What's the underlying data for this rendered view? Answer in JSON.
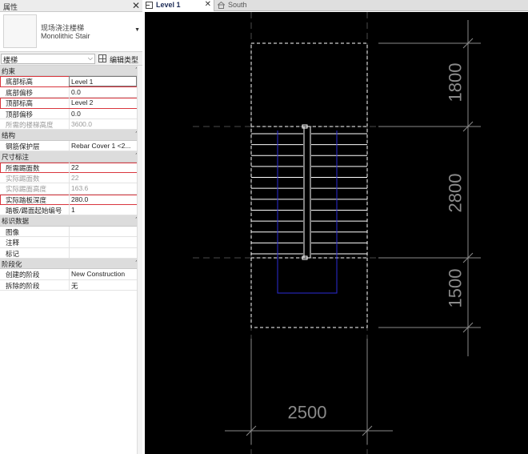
{
  "properties_panel": {
    "title": "属性",
    "close_glyph": "✕",
    "type_name": "现场浇注楼梯",
    "type_subname": "Monolithic Stair",
    "filter_value": "楼梯",
    "edit_type_label": "编辑类型",
    "categories": [
      {
        "label": "约束",
        "rows": [
          {
            "label": "底部标高",
            "value": "Level 1",
            "highlight": true,
            "active": true,
            "readonly": false
          },
          {
            "label": "底部偏移",
            "value": "0.0",
            "highlight": false,
            "active": false,
            "readonly": false
          },
          {
            "label": "顶部标高",
            "value": "Level 2",
            "highlight": true,
            "active": false,
            "readonly": false
          },
          {
            "label": "顶部偏移",
            "value": "0.0",
            "highlight": false,
            "active": false,
            "readonly": false
          },
          {
            "label": "所需的楼梯高度",
            "value": "3600.0",
            "highlight": false,
            "active": false,
            "readonly": true
          }
        ]
      },
      {
        "label": "结构",
        "rows": [
          {
            "label": "钢筋保护层",
            "value": "Rebar Cover 1 <2...",
            "highlight": false,
            "active": false,
            "readonly": false
          }
        ]
      },
      {
        "label": "尺寸标注",
        "rows": [
          {
            "label": "所需踢面数",
            "value": "22",
            "highlight": true,
            "active": false,
            "readonly": false
          },
          {
            "label": "实际踢面数",
            "value": "22",
            "highlight": false,
            "active": false,
            "readonly": true
          },
          {
            "label": "实际踢面高度",
            "value": "163.6",
            "highlight": false,
            "active": false,
            "readonly": true
          },
          {
            "label": "实际踏板深度",
            "value": "280.0",
            "highlight": true,
            "active": false,
            "readonly": false
          },
          {
            "label": "踏板/踢面起始编号",
            "value": "1",
            "highlight": false,
            "active": false,
            "readonly": false
          }
        ]
      },
      {
        "label": "标识数据",
        "rows": [
          {
            "label": "图像",
            "value": "",
            "highlight": false,
            "active": false,
            "readonly": false
          },
          {
            "label": "注释",
            "value": "",
            "highlight": false,
            "active": false,
            "readonly": false
          },
          {
            "label": "标记",
            "value": "",
            "highlight": false,
            "active": false,
            "readonly": false
          }
        ]
      },
      {
        "label": "阶段化",
        "rows": [
          {
            "label": "创建的阶段",
            "value": "New Construction",
            "highlight": false,
            "active": false,
            "readonly": false
          },
          {
            "label": "拆除的阶段",
            "value": "无",
            "highlight": false,
            "active": false,
            "readonly": false
          }
        ]
      }
    ]
  },
  "tabs": [
    {
      "label": "Level 1",
      "active": true,
      "closable": true,
      "icon": "floor-plan-icon"
    },
    {
      "label": "South",
      "active": false,
      "closable": false,
      "icon": "elevation-icon"
    }
  ],
  "drawing": {
    "dimensions": {
      "landing_top": "1800",
      "stair_run": "2800",
      "landing_bottom": "1500",
      "width": "2500"
    },
    "colors": {
      "background": "#000000",
      "lines": "#ffffff",
      "dimension": "#8a8a8a",
      "run_path": "#2b2bd6",
      "highlight": "#d9363e"
    }
  }
}
